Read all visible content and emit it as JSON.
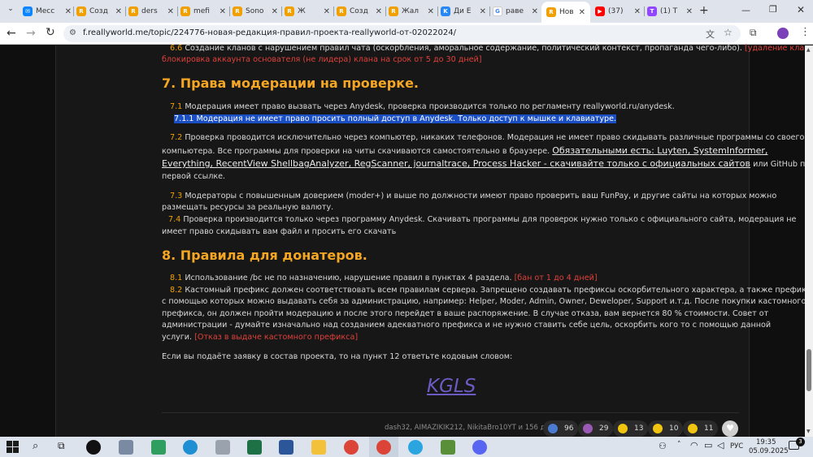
{
  "tabs": [
    {
      "label": "Месс",
      "icon": "messenger-icon",
      "color": "#0a84ff"
    },
    {
      "label": "Созд",
      "icon": "forum-icon",
      "color": "#f0a000"
    },
    {
      "label": "ders",
      "icon": "forum-icon",
      "color": "#f0a000"
    },
    {
      "label": "mefi",
      "icon": "forum-icon",
      "color": "#f0a000"
    },
    {
      "label": "Sono",
      "icon": "forum-icon",
      "color": "#f0a000"
    },
    {
      "label": "Ж",
      "icon": "forum-icon",
      "color": "#f0a000"
    },
    {
      "label": "Созд",
      "icon": "forum-icon",
      "color": "#f0a000"
    },
    {
      "label": "Жал",
      "icon": "forum-icon",
      "color": "#f0a000"
    },
    {
      "label": "Ди Е",
      "icon": "vk-icon",
      "color": "#2787f5"
    },
    {
      "label": "раве",
      "icon": "google-icon",
      "color": "#4285f4"
    },
    {
      "label": "Нов",
      "icon": "forum-icon",
      "color": "#f0a000"
    },
    {
      "label": "(37)",
      "icon": "youtube-icon",
      "color": "#ff0000"
    },
    {
      "label": "(1) T",
      "icon": "twitch-icon",
      "color": "#9146ff"
    }
  ],
  "browser": {
    "url": "f.reallyworld.me/topic/224776-новая-редакция-правил-проекта-reallyworld-от-02022024/"
  },
  "post": {
    "r66_num": "6.6",
    "r66_text_a": "Создание кланов с нарушением правил чата (оскорбления, аморальное содержание, политический контекст, пропаганда чего-либо).",
    "r66_penalty_a": "[удаление клана,",
    "r66_penalty_b": "блокировка аккаунта основателя (не лидера) клана на срок от 5 до 30 дней]",
    "h7": "7. Права модерации на проверке.",
    "r71_num": "7.1",
    "r71_text": "Модерация имеет право вызвать через Anydesk, проверка производится только по регламенту reallyworld.ru/anydesk.",
    "r711_text": "7.1.1 Модерация не имеет право просить полный доступ в Anydesk. Только доступ к мышке и клавиатуре.",
    "r72_num": "7.2",
    "r72_l1": "Проверка проводится исключительно через компьютер, никаких телефонов. Модерация не имеет право скидывать различные программы со своего",
    "r72_l2a": "компьютера. Все программы для проверки на читы скачиваются самостоятельно в браузере.",
    "r72_l2b": "Обязательными есть: Luyten, SystemInformer,",
    "r72_l3a": "Everything, RecentView ShellbagAnalyzer, RegScanner, journaltrace, Process Hacker - скачивайте только с официальных сайтов",
    "r72_l3b": "или GitHub по",
    "r72_l4": "первой ссылке.",
    "r73_num": "7.3",
    "r73_l1": "Модераторы с повышенным доверием (moder+) и выше по должности имеют право проверить ваш FunPay, и другие сайты на которых можно",
    "r73_l2": "размещать ресурсы за реальную валюту.",
    "r74_num": "7.4",
    "r74_l1": "Проверка производится только через программу Anydesk. Скачивать программы для проверок нужно только с официального сайта, модерация не",
    "r74_l2": "имеет право скидывать вам файл и просить его скачать",
    "h8": "8. Правила для донатеров.",
    "r81_num": "8.1",
    "r81_text": "Использование /bc не по назначению, нарушение правил в пунктах 4 раздела.",
    "r81_penalty": "[бан от 1 до 4 дней]",
    "r82_num": "8.2",
    "r82_l1": "Кастомный префикс должен соответствовать всем правилам сервера. Запрещено создавать префиксы оскорбительного характера, а также префиксы",
    "r82_l2": "с помощью которых можно выдавать себя за администрацию, например: Helper, Moder, Admin, Owner, Deweloper, Support и.т.д. После покупки кастомного",
    "r82_l3": "префикса, он должен пройти модерацию и после этого перейдет в ваше распоряжение. В случае отказа, вам вернется 80 % стоимости. Совет от",
    "r82_l4": "администрации - думайте изначально над созданием адекватного префикса и не нужно ставить себе цель, оскорбить кого то с помощью данной",
    "r82_l5": "услуги.",
    "r82_penalty": "[Отказ в выдаче кастомного префикса]",
    "apply_text": "Если вы подаёте заявку в состав проекта, то на пункт 12 ответьте кодовым словом:",
    "code_word": "KGLS",
    "likers": "dash32, AIMAZIKIK212, NikitaBro10YT и 156 других"
  },
  "reactions": [
    {
      "icon": "heart-icon",
      "count": "96",
      "color": "#4a7bd0"
    },
    {
      "icon": "star-face-icon",
      "count": "29",
      "color": "#9b59b6"
    },
    {
      "icon": "laugh-icon",
      "count": "13",
      "color": "#f1c40f"
    },
    {
      "icon": "wow-icon",
      "count": "10",
      "color": "#f1c40f"
    },
    {
      "icon": "sad-icon",
      "count": "11",
      "color": "#f1c40f"
    }
  ],
  "taskbar": {
    "lang": "РУС",
    "time": "19:35",
    "date": "05.09.2025",
    "notif_count": "3"
  }
}
